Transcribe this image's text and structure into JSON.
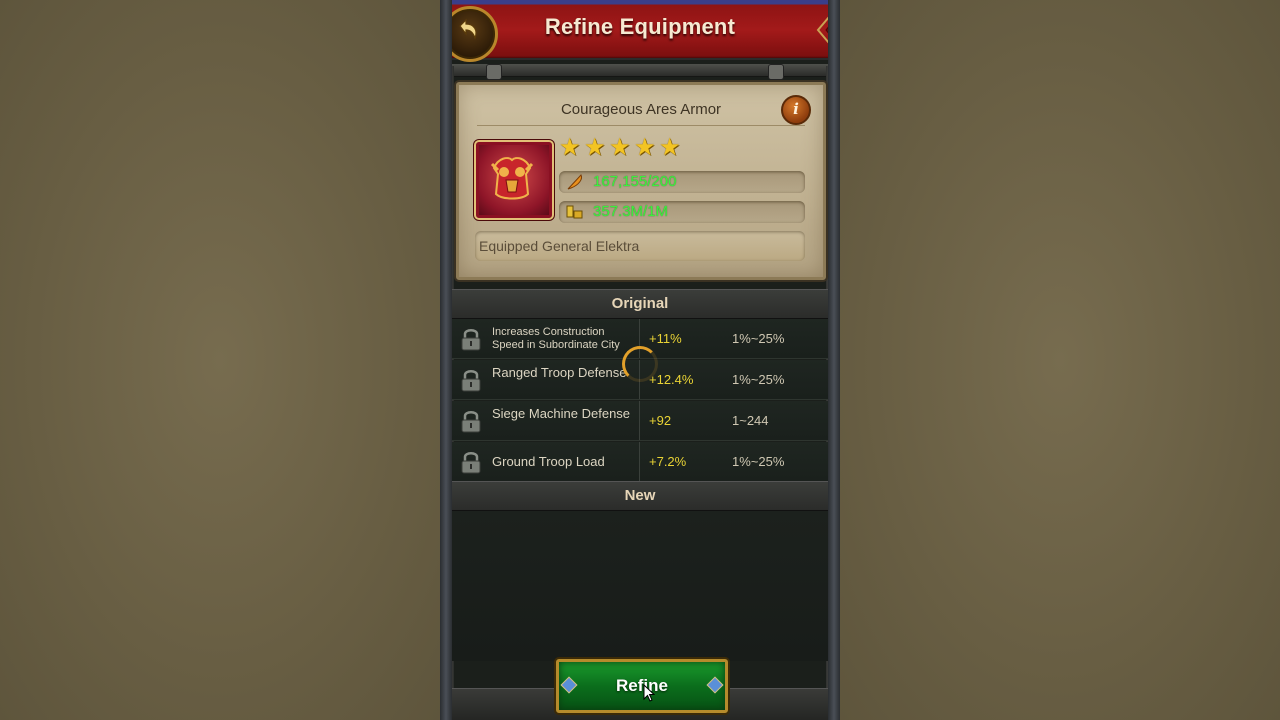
{
  "header": {
    "title": "Refine Equipment",
    "back_icon": "back-arrow-icon"
  },
  "item": {
    "name": "Courageous Ares Armor",
    "info_icon_text": "i",
    "stars": 5,
    "progress_text": "167,155/200",
    "cost_text": "357.3M/1M",
    "equipped_text": "Equipped General Elektra"
  },
  "sections": {
    "original": "Original",
    "new": "New"
  },
  "attributes": [
    {
      "name": "Increases Construction Speed in Subordinate City",
      "value": "+11%",
      "range": "1%~25%"
    },
    {
      "name": "Ranged Troop Defense",
      "value": "+12.4%",
      "range": "1%~25%"
    },
    {
      "name": "Siege Machine Defense",
      "value": "+92",
      "range": "1~244"
    },
    {
      "name": "Ground Troop Load",
      "value": "+7.2%",
      "range": "1%~25%"
    }
  ],
  "refine_button": {
    "label": "Refine"
  },
  "colors": {
    "header_red": "#a31a1a",
    "value_green": "#3df03d",
    "value_yellow": "#e9d335",
    "button_green": "#0b6e1c"
  }
}
